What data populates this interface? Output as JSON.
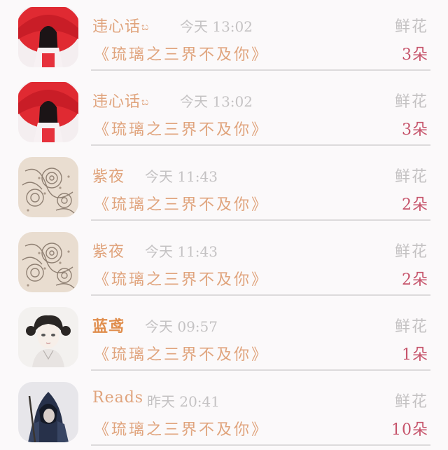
{
  "gift_list": {
    "flower_label": "鲜花",
    "rows": [
      {
        "name": "违心话",
        "name_icon": "heart-icon",
        "has_name_icon": true,
        "name_color": "#e0a47d",
        "time": "今天 13:02",
        "book": "《琉璃之三界不及你》",
        "count": "3朵",
        "avatar": "red-umbrella-girl"
      },
      {
        "name": "违心话",
        "name_icon": "heart-icon",
        "has_name_icon": true,
        "name_color": "#e0a47d",
        "time": "今天 13:02",
        "book": "《琉璃之三界不及你》",
        "count": "3朵",
        "avatar": "red-umbrella-girl"
      },
      {
        "name": "紫夜",
        "has_name_icon": false,
        "name_color": "#e0a47d",
        "time": "今天 11:43",
        "book": "《琉璃之三界不及你》",
        "count": "2朵",
        "avatar": "lace-pattern"
      },
      {
        "name": "紫夜",
        "has_name_icon": false,
        "name_color": "#e0a47d",
        "time": "今天 11:43",
        "book": "《琉璃之三界不及你》",
        "count": "2朵",
        "avatar": "lace-pattern"
      },
      {
        "name": "蓝鸢",
        "has_name_icon": false,
        "name_color": "#e08d4c",
        "time": "今天 09:57",
        "book": "《琉璃之三界不及你》",
        "count": "1朵",
        "avatar": "sketch-girl"
      },
      {
        "name": "Reads",
        "has_name_icon": false,
        "name_color": "#e0a47d",
        "time": "昨天 20:41",
        "book": "《琉璃之三界不及你》",
        "count": "10朵",
        "avatar": "hooded-figure"
      }
    ]
  }
}
